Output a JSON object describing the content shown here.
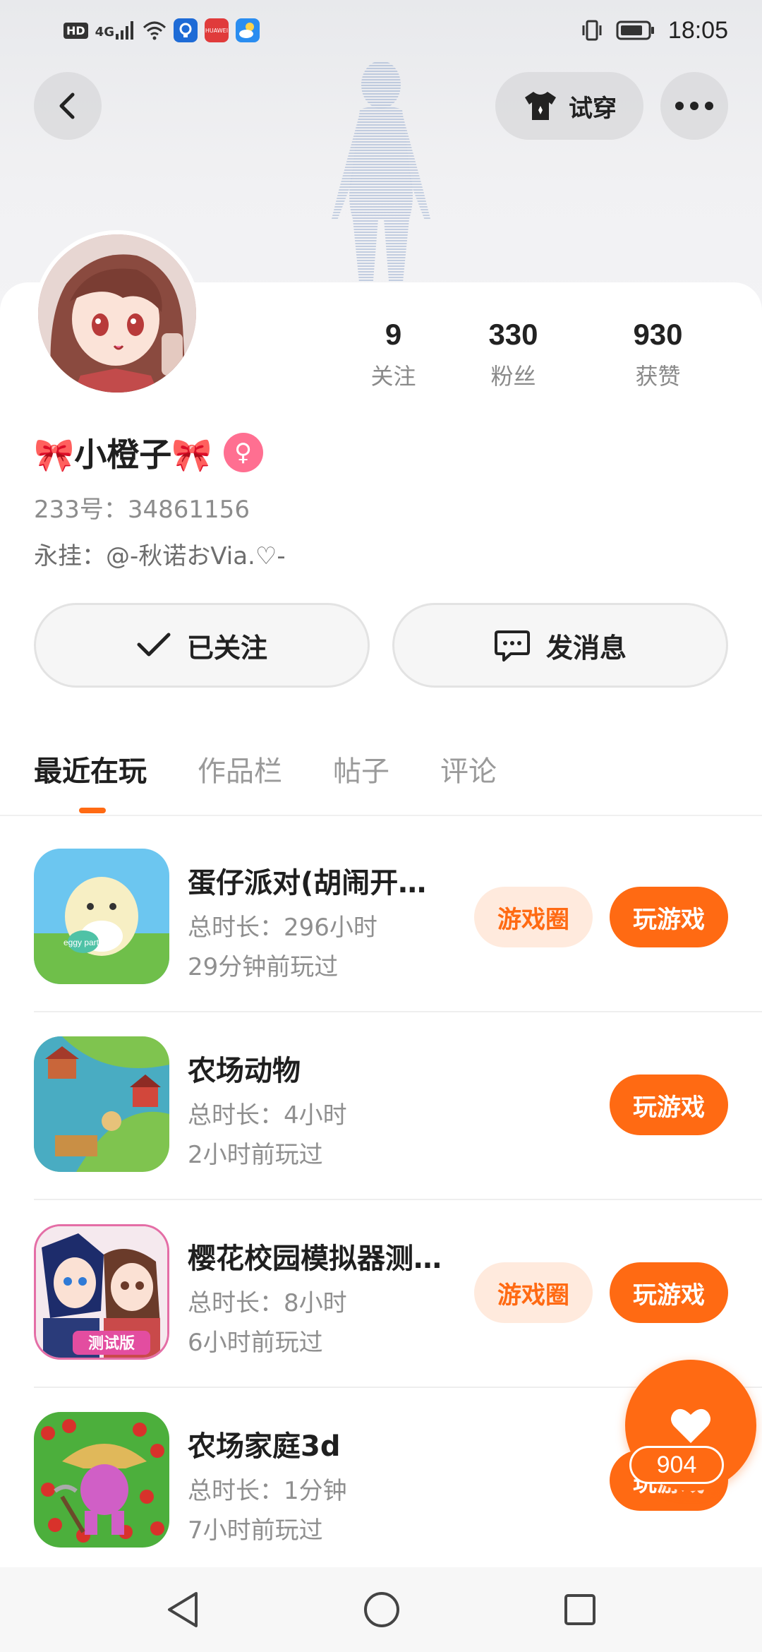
{
  "status_bar": {
    "left_icons": [
      "hd-icon",
      "4g-signal-icon",
      "wifi-icon",
      "app-notification-icon",
      "huawei-app-icon",
      "weather-app-icon"
    ],
    "hd_label": "HD",
    "network_label": "4G",
    "huawei_label": "HUAWEI",
    "time": "18:05"
  },
  "topbar": {
    "try_on_label": "试穿"
  },
  "profile": {
    "name": "🎀小橙子🎀",
    "uid": "233号：34861156",
    "pendant": "永挂：@-秋诺おVia.♡-",
    "stats": [
      {
        "num": "9",
        "label": "关注"
      },
      {
        "num": "330",
        "label": "粉丝"
      },
      {
        "num": "930",
        "label": "获赞"
      }
    ]
  },
  "actions": {
    "follow_label": "已关注",
    "message_label": "发消息"
  },
  "tabs": [
    "最近在玩",
    "作品栏",
    "帖子",
    "评论"
  ],
  "games": [
    {
      "title": "蛋仔派对(胡闹开…",
      "time": "总时长：296小时",
      "last": "29分钟前玩过",
      "has_circle": true,
      "circle_label": "游戏圈",
      "play_label": "玩游戏",
      "icon_text": "eggy party"
    },
    {
      "title": "农场动物",
      "time": "总时长：4小时",
      "last": "2小时前玩过",
      "has_circle": false,
      "circle_label": "",
      "play_label": "玩游戏",
      "icon_text": ""
    },
    {
      "title": "樱花校园模拟器测…",
      "time": "总时长：8小时",
      "last": "6小时前玩过",
      "has_circle": true,
      "circle_label": "游戏圈",
      "play_label": "玩游戏",
      "icon_text": "测试版"
    },
    {
      "title": "农场家庭3d",
      "time": "总时长：1分钟",
      "last": "7小时前玩过",
      "has_circle": false,
      "circle_label": "",
      "play_label": "玩游戏",
      "icon_text": ""
    }
  ],
  "fab": {
    "count": "904"
  },
  "colors": {
    "accent": "#ff6a13",
    "accent_light": "#ffeadd",
    "female": "#ff6f91"
  }
}
